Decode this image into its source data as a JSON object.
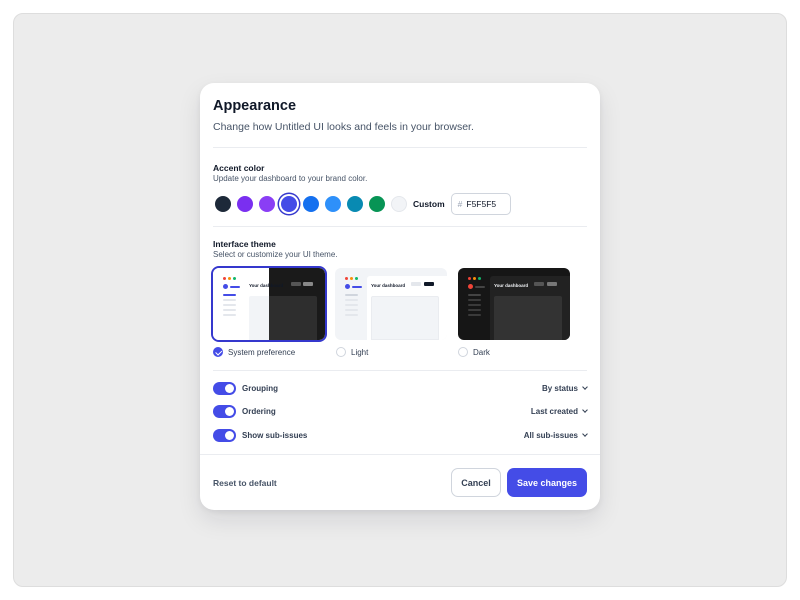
{
  "header": {
    "title": "Appearance",
    "subtitle": "Change how Untitled UI looks and feels in your browser."
  },
  "accent": {
    "title": "Accent color",
    "subtitle": "Update your dashboard to your brand color.",
    "swatches": [
      {
        "name": "black",
        "color": "#1d2939",
        "selected": false
      },
      {
        "name": "purple",
        "color": "#7a2ff0",
        "selected": false
      },
      {
        "name": "violet",
        "color": "#8a3ef5",
        "selected": false
      },
      {
        "name": "indigo",
        "color": "#444ce7",
        "selected": true
      },
      {
        "name": "blue",
        "color": "#1570ef",
        "selected": false
      },
      {
        "name": "light-blue",
        "color": "#2e90fa",
        "selected": false
      },
      {
        "name": "teal",
        "color": "#088ab2",
        "selected": false
      },
      {
        "name": "green",
        "color": "#079455",
        "selected": false
      },
      {
        "name": "light-gray",
        "color": "#f2f4f7",
        "selected": false
      }
    ],
    "custom_label": "Custom",
    "hex_prefix": "#",
    "hex_value": "F5F5F5"
  },
  "theme": {
    "title": "Interface theme",
    "subtitle": "Select or customize your UI theme.",
    "options": [
      {
        "label": "System preference",
        "checked": true,
        "mock_title": "Your dashboard"
      },
      {
        "label": "Light",
        "checked": false,
        "mock_title": "Your dashboard"
      },
      {
        "label": "Dark",
        "checked": false,
        "mock_title": "Your dashboard"
      }
    ]
  },
  "toggles": [
    {
      "label": "Grouping",
      "value": "By status",
      "on": true
    },
    {
      "label": "Ordering",
      "value": "Last created",
      "on": true
    },
    {
      "label": "Show sub-issues",
      "value": "All sub-issues",
      "on": true
    }
  ],
  "footer": {
    "reset_label": "Reset to default",
    "cancel_label": "Cancel",
    "save_label": "Save changes"
  },
  "colors": {
    "primary": "#444ce7",
    "selected_ring": "#3538cd",
    "backdrop": "#ececec"
  }
}
